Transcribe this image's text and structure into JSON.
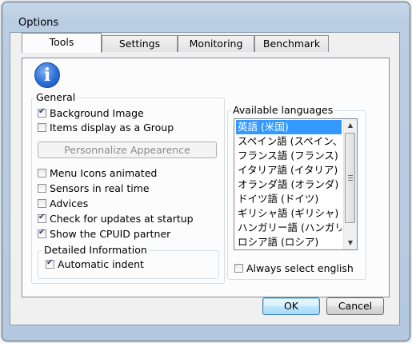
{
  "window": {
    "title": "Options"
  },
  "tabs": [
    {
      "label": "Tools",
      "active": true
    },
    {
      "label": "Settings",
      "active": false
    },
    {
      "label": "Monitoring",
      "active": false
    },
    {
      "label": "Benchmark",
      "active": false
    }
  ],
  "info_icon": "info-icon",
  "general": {
    "label": "General",
    "background_image": {
      "label": "Background Image",
      "checked": true
    },
    "items_group": {
      "label": "Items display as a Group",
      "checked": false
    },
    "personalize_button": {
      "label": "Personnalize Appearence",
      "enabled": false
    },
    "menu_icons": {
      "label": "Menu Icons animated",
      "checked": false
    },
    "sensors": {
      "label": "Sensors in real time",
      "checked": false
    },
    "advices": {
      "label": "Advices",
      "checked": false
    },
    "check_updates": {
      "label": "Check for updates at startup",
      "checked": true
    },
    "cpuid_partner": {
      "label": "Show the CPUID partner",
      "checked": true
    }
  },
  "detailed": {
    "label": "Detailed Information",
    "automatic_indent": {
      "label": "Automatic indent",
      "checked": true
    }
  },
  "languages": {
    "label": "Available languages",
    "items": [
      "英語 (米国)",
      "スペイン語 (スペイン、インターナショナル ソート)",
      "フランス語 (フランス)",
      "イタリア語 (イタリア)",
      "オランダ語 (オランダ)",
      "ドイツ語 (ドイツ)",
      "ギリシャ語 (ギリシャ)",
      "ハンガリー語 (ハンガリー)",
      "ロシア語 (ロシア)"
    ],
    "selected_index": 0,
    "always_english": {
      "label": "Always select english",
      "checked": false
    }
  },
  "buttons": {
    "ok": "OK",
    "cancel": "Cancel"
  }
}
